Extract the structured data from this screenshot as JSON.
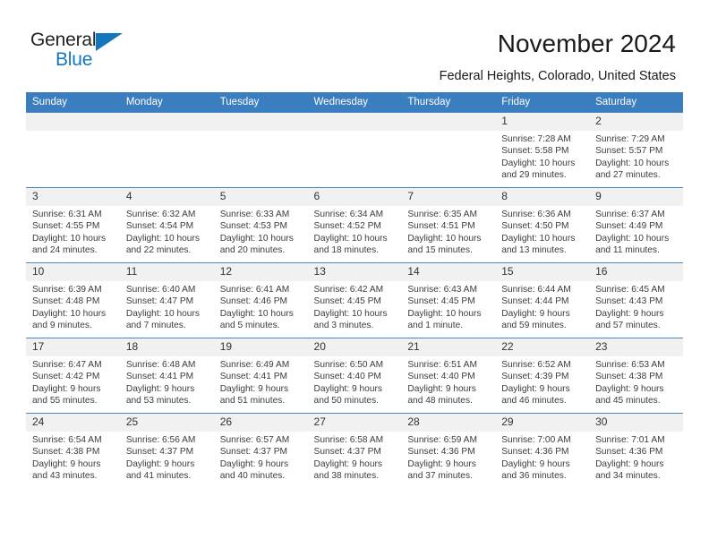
{
  "brand": {
    "name_top": "General",
    "name_bottom": "Blue",
    "color_blue": "#1277bd",
    "color_dark": "#231f20"
  },
  "header": {
    "title": "November 2024",
    "location": "Federal Heights, Colorado, United States"
  },
  "theme": {
    "header_row_bg": "#3b7ebf",
    "daynum_bg": "#f1f1f1",
    "page_bg": "#ffffff",
    "text": "#3c3c3c"
  },
  "weekday_headers": [
    "Sunday",
    "Monday",
    "Tuesday",
    "Wednesday",
    "Thursday",
    "Friday",
    "Saturday"
  ],
  "labels": {
    "sunrise_prefix": "Sunrise:",
    "sunset_prefix": "Sunset:",
    "daylight_prefix": "Daylight:"
  },
  "weeks": [
    [
      {
        "day": "",
        "blank": true
      },
      {
        "day": "",
        "blank": true
      },
      {
        "day": "",
        "blank": true
      },
      {
        "day": "",
        "blank": true
      },
      {
        "day": "",
        "blank": true
      },
      {
        "day": "1",
        "sunrise": "Sunrise: 7:28 AM",
        "sunset": "Sunset: 5:58 PM",
        "daylight": "Daylight: 10 hours and 29 minutes."
      },
      {
        "day": "2",
        "sunrise": "Sunrise: 7:29 AM",
        "sunset": "Sunset: 5:57 PM",
        "daylight": "Daylight: 10 hours and 27 minutes."
      }
    ],
    [
      {
        "day": "3",
        "sunrise": "Sunrise: 6:31 AM",
        "sunset": "Sunset: 4:55 PM",
        "daylight": "Daylight: 10 hours and 24 minutes."
      },
      {
        "day": "4",
        "sunrise": "Sunrise: 6:32 AM",
        "sunset": "Sunset: 4:54 PM",
        "daylight": "Daylight: 10 hours and 22 minutes."
      },
      {
        "day": "5",
        "sunrise": "Sunrise: 6:33 AM",
        "sunset": "Sunset: 4:53 PM",
        "daylight": "Daylight: 10 hours and 20 minutes."
      },
      {
        "day": "6",
        "sunrise": "Sunrise: 6:34 AM",
        "sunset": "Sunset: 4:52 PM",
        "daylight": "Daylight: 10 hours and 18 minutes."
      },
      {
        "day": "7",
        "sunrise": "Sunrise: 6:35 AM",
        "sunset": "Sunset: 4:51 PM",
        "daylight": "Daylight: 10 hours and 15 minutes."
      },
      {
        "day": "8",
        "sunrise": "Sunrise: 6:36 AM",
        "sunset": "Sunset: 4:50 PM",
        "daylight": "Daylight: 10 hours and 13 minutes."
      },
      {
        "day": "9",
        "sunrise": "Sunrise: 6:37 AM",
        "sunset": "Sunset: 4:49 PM",
        "daylight": "Daylight: 10 hours and 11 minutes."
      }
    ],
    [
      {
        "day": "10",
        "sunrise": "Sunrise: 6:39 AM",
        "sunset": "Sunset: 4:48 PM",
        "daylight": "Daylight: 10 hours and 9 minutes."
      },
      {
        "day": "11",
        "sunrise": "Sunrise: 6:40 AM",
        "sunset": "Sunset: 4:47 PM",
        "daylight": "Daylight: 10 hours and 7 minutes."
      },
      {
        "day": "12",
        "sunrise": "Sunrise: 6:41 AM",
        "sunset": "Sunset: 4:46 PM",
        "daylight": "Daylight: 10 hours and 5 minutes."
      },
      {
        "day": "13",
        "sunrise": "Sunrise: 6:42 AM",
        "sunset": "Sunset: 4:45 PM",
        "daylight": "Daylight: 10 hours and 3 minutes."
      },
      {
        "day": "14",
        "sunrise": "Sunrise: 6:43 AM",
        "sunset": "Sunset: 4:45 PM",
        "daylight": "Daylight: 10 hours and 1 minute."
      },
      {
        "day": "15",
        "sunrise": "Sunrise: 6:44 AM",
        "sunset": "Sunset: 4:44 PM",
        "daylight": "Daylight: 9 hours and 59 minutes."
      },
      {
        "day": "16",
        "sunrise": "Sunrise: 6:45 AM",
        "sunset": "Sunset: 4:43 PM",
        "daylight": "Daylight: 9 hours and 57 minutes."
      }
    ],
    [
      {
        "day": "17",
        "sunrise": "Sunrise: 6:47 AM",
        "sunset": "Sunset: 4:42 PM",
        "daylight": "Daylight: 9 hours and 55 minutes."
      },
      {
        "day": "18",
        "sunrise": "Sunrise: 6:48 AM",
        "sunset": "Sunset: 4:41 PM",
        "daylight": "Daylight: 9 hours and 53 minutes."
      },
      {
        "day": "19",
        "sunrise": "Sunrise: 6:49 AM",
        "sunset": "Sunset: 4:41 PM",
        "daylight": "Daylight: 9 hours and 51 minutes."
      },
      {
        "day": "20",
        "sunrise": "Sunrise: 6:50 AM",
        "sunset": "Sunset: 4:40 PM",
        "daylight": "Daylight: 9 hours and 50 minutes."
      },
      {
        "day": "21",
        "sunrise": "Sunrise: 6:51 AM",
        "sunset": "Sunset: 4:40 PM",
        "daylight": "Daylight: 9 hours and 48 minutes."
      },
      {
        "day": "22",
        "sunrise": "Sunrise: 6:52 AM",
        "sunset": "Sunset: 4:39 PM",
        "daylight": "Daylight: 9 hours and 46 minutes."
      },
      {
        "day": "23",
        "sunrise": "Sunrise: 6:53 AM",
        "sunset": "Sunset: 4:38 PM",
        "daylight": "Daylight: 9 hours and 45 minutes."
      }
    ],
    [
      {
        "day": "24",
        "sunrise": "Sunrise: 6:54 AM",
        "sunset": "Sunset: 4:38 PM",
        "daylight": "Daylight: 9 hours and 43 minutes."
      },
      {
        "day": "25",
        "sunrise": "Sunrise: 6:56 AM",
        "sunset": "Sunset: 4:37 PM",
        "daylight": "Daylight: 9 hours and 41 minutes."
      },
      {
        "day": "26",
        "sunrise": "Sunrise: 6:57 AM",
        "sunset": "Sunset: 4:37 PM",
        "daylight": "Daylight: 9 hours and 40 minutes."
      },
      {
        "day": "27",
        "sunrise": "Sunrise: 6:58 AM",
        "sunset": "Sunset: 4:37 PM",
        "daylight": "Daylight: 9 hours and 38 minutes."
      },
      {
        "day": "28",
        "sunrise": "Sunrise: 6:59 AM",
        "sunset": "Sunset: 4:36 PM",
        "daylight": "Daylight: 9 hours and 37 minutes."
      },
      {
        "day": "29",
        "sunrise": "Sunrise: 7:00 AM",
        "sunset": "Sunset: 4:36 PM",
        "daylight": "Daylight: 9 hours and 36 minutes."
      },
      {
        "day": "30",
        "sunrise": "Sunrise: 7:01 AM",
        "sunset": "Sunset: 4:36 PM",
        "daylight": "Daylight: 9 hours and 34 minutes."
      }
    ]
  ]
}
